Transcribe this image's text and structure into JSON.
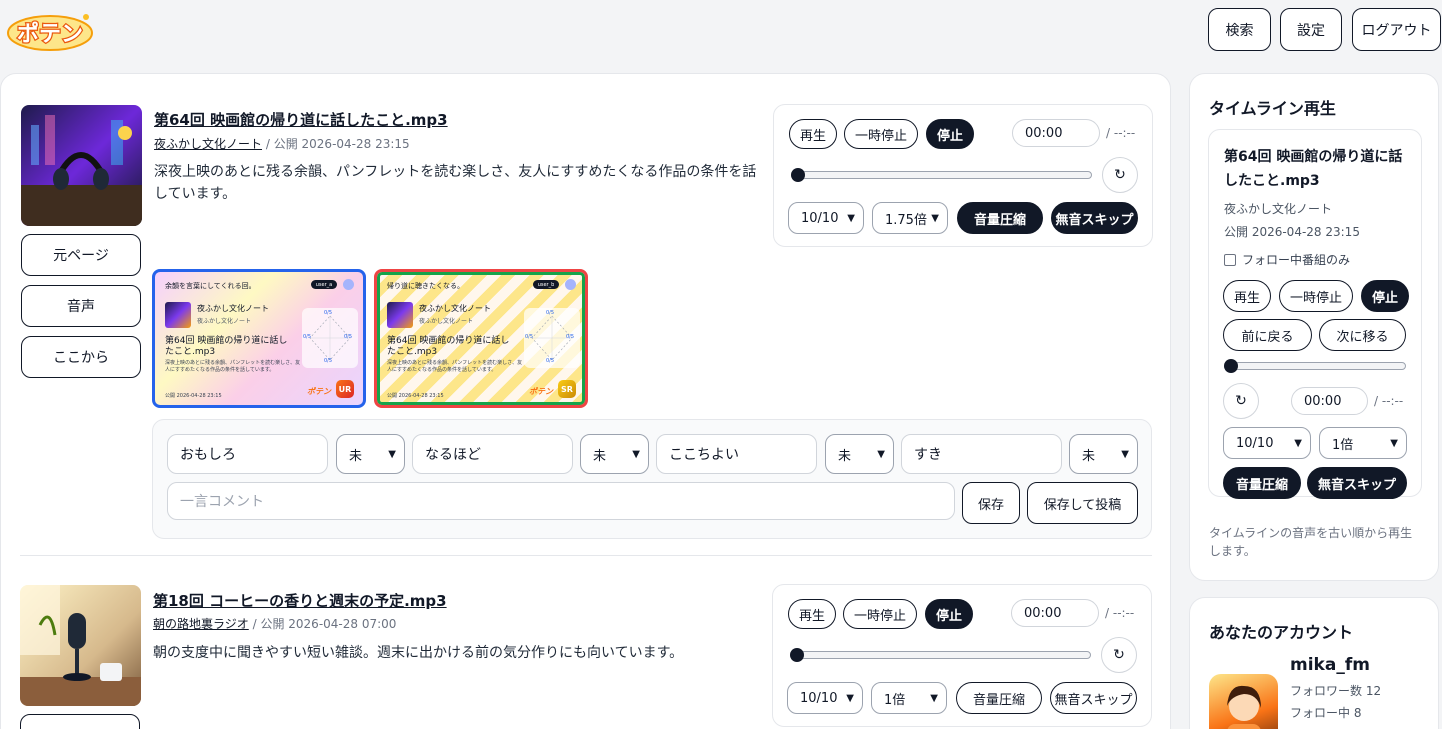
{
  "header": {
    "logo_text": "ポテン",
    "buttons": {
      "search": "検索",
      "settings": "設定",
      "logout": "ログアウト"
    }
  },
  "colors": {
    "accent": "#111827",
    "logo_orange": "#f59e0b",
    "ur_border": "#2563eb",
    "sr_border": "#ef4444",
    "sr_inner": "#16a34a"
  },
  "side_buttons": {
    "source_page": "元ページ",
    "audio": "音声",
    "from_here": "ここから"
  },
  "player_labels": {
    "play": "再生",
    "pause": "一時停止",
    "stop": "停止",
    "time": "00:00",
    "duration": "/ --:--",
    "reload_icon": "↻",
    "compress": "音量圧縮",
    "skip_silence": "無音スキップ"
  },
  "episodes": [
    {
      "title": "第64回 映画館の帰り道に話したこと.mp3",
      "program": "夜ふかし文化ノート",
      "visibility": "/ 公開",
      "date": "2026-04-28 23:15",
      "description": "深夜上映のあとに残る余韻、パンフレットを読む楽しさ、友人にすすめたくなる作品の条件を話しています。",
      "volume": "10/10",
      "speed": "1.75倍",
      "progress": 0
    },
    {
      "title": "第18回 コーヒーの香りと週末の予定.mp3",
      "program": "朝の路地裏ラジオ",
      "visibility": "/ 公開",
      "date": "2026-04-28 07:00",
      "description": "朝の支度中に聞きやすい短い雑談。週末に出かける前の気分作りにも向いています。",
      "volume": "10/10",
      "speed": "1倍",
      "progress": 0
    }
  ],
  "cards": [
    {
      "caption": "余韻を言葉にしてくれる回。",
      "user": "user_a",
      "program": "夜ふかし文化ノート",
      "program_sub": "夜ふかし文化ノート",
      "episode": "第64回 映画館の帰り道に話したこと.mp3",
      "desc": "深夜上映のあとに残る余韻、パンフレットを読む楽しさ、友人にすすめたくなる作品の条件を話しています。",
      "date": "公開 2026-04-28 23:15",
      "rank": "UR",
      "logo": "ポテン",
      "radar": [
        "0/5",
        "0/5",
        "0/5",
        "0/5"
      ]
    },
    {
      "caption": "帰り道に聴きたくなる。",
      "user": "user_b",
      "program": "夜ふかし文化ノート",
      "program_sub": "夜ふかし文化ノート",
      "episode": "第64回 映画館の帰り道に話したこと.mp3",
      "desc": "深夜上映のあとに残る余韻、パンフレットを読む楽しさ、友人にすすめたくなる作品の条件を話しています。",
      "date": "公開 2026-04-28 23:15",
      "rank": "SR",
      "logo": "ポテン",
      "radar": [
        "0/5",
        "0/5",
        "0/5",
        "0/5"
      ]
    }
  ],
  "ratings": {
    "items": [
      {
        "label": "おもしろ",
        "value": "未"
      },
      {
        "label": "なるほど",
        "value": "未"
      },
      {
        "label": "ここちよい",
        "value": "未"
      },
      {
        "label": "すき",
        "value": "未"
      }
    ],
    "comment_placeholder": "一言コメント",
    "save": "保存",
    "save_post": "保存して投稿"
  },
  "timeline": {
    "heading": "タイムライン再生",
    "title": "第64回 映画館の帰り道に話したこと.mp3",
    "program": "夜ふかし文化ノート",
    "date": "公開 2026-04-28 23:15",
    "follow_only": "フォロー中番組のみ",
    "prev": "前に戻る",
    "next": "次に移る",
    "volume": "10/10",
    "speed": "1倍",
    "note": "タイムラインの音声を古い順から再生します。"
  },
  "account": {
    "heading": "あなたのアカウント",
    "username": "mika_fm",
    "followers": "フォロワー数 12",
    "following": "フォロー中 8"
  }
}
